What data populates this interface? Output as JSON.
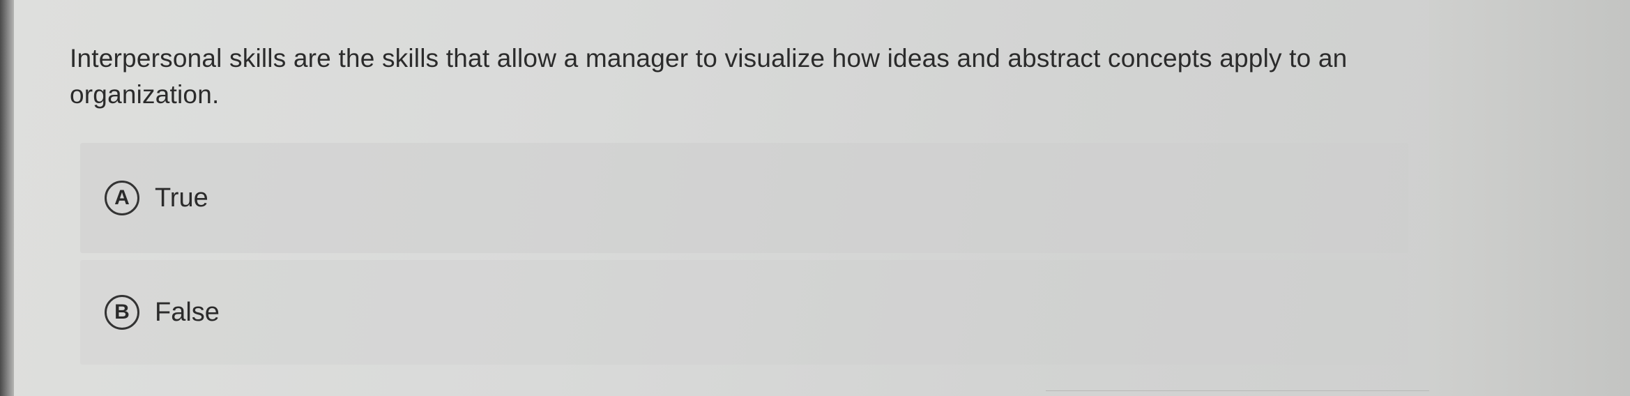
{
  "question": {
    "text": "Interpersonal skills are the skills that allow a manager to visualize how ideas and abstract concepts apply to an organization."
  },
  "options": [
    {
      "letter": "A",
      "label": "True"
    },
    {
      "letter": "B",
      "label": "False"
    }
  ]
}
